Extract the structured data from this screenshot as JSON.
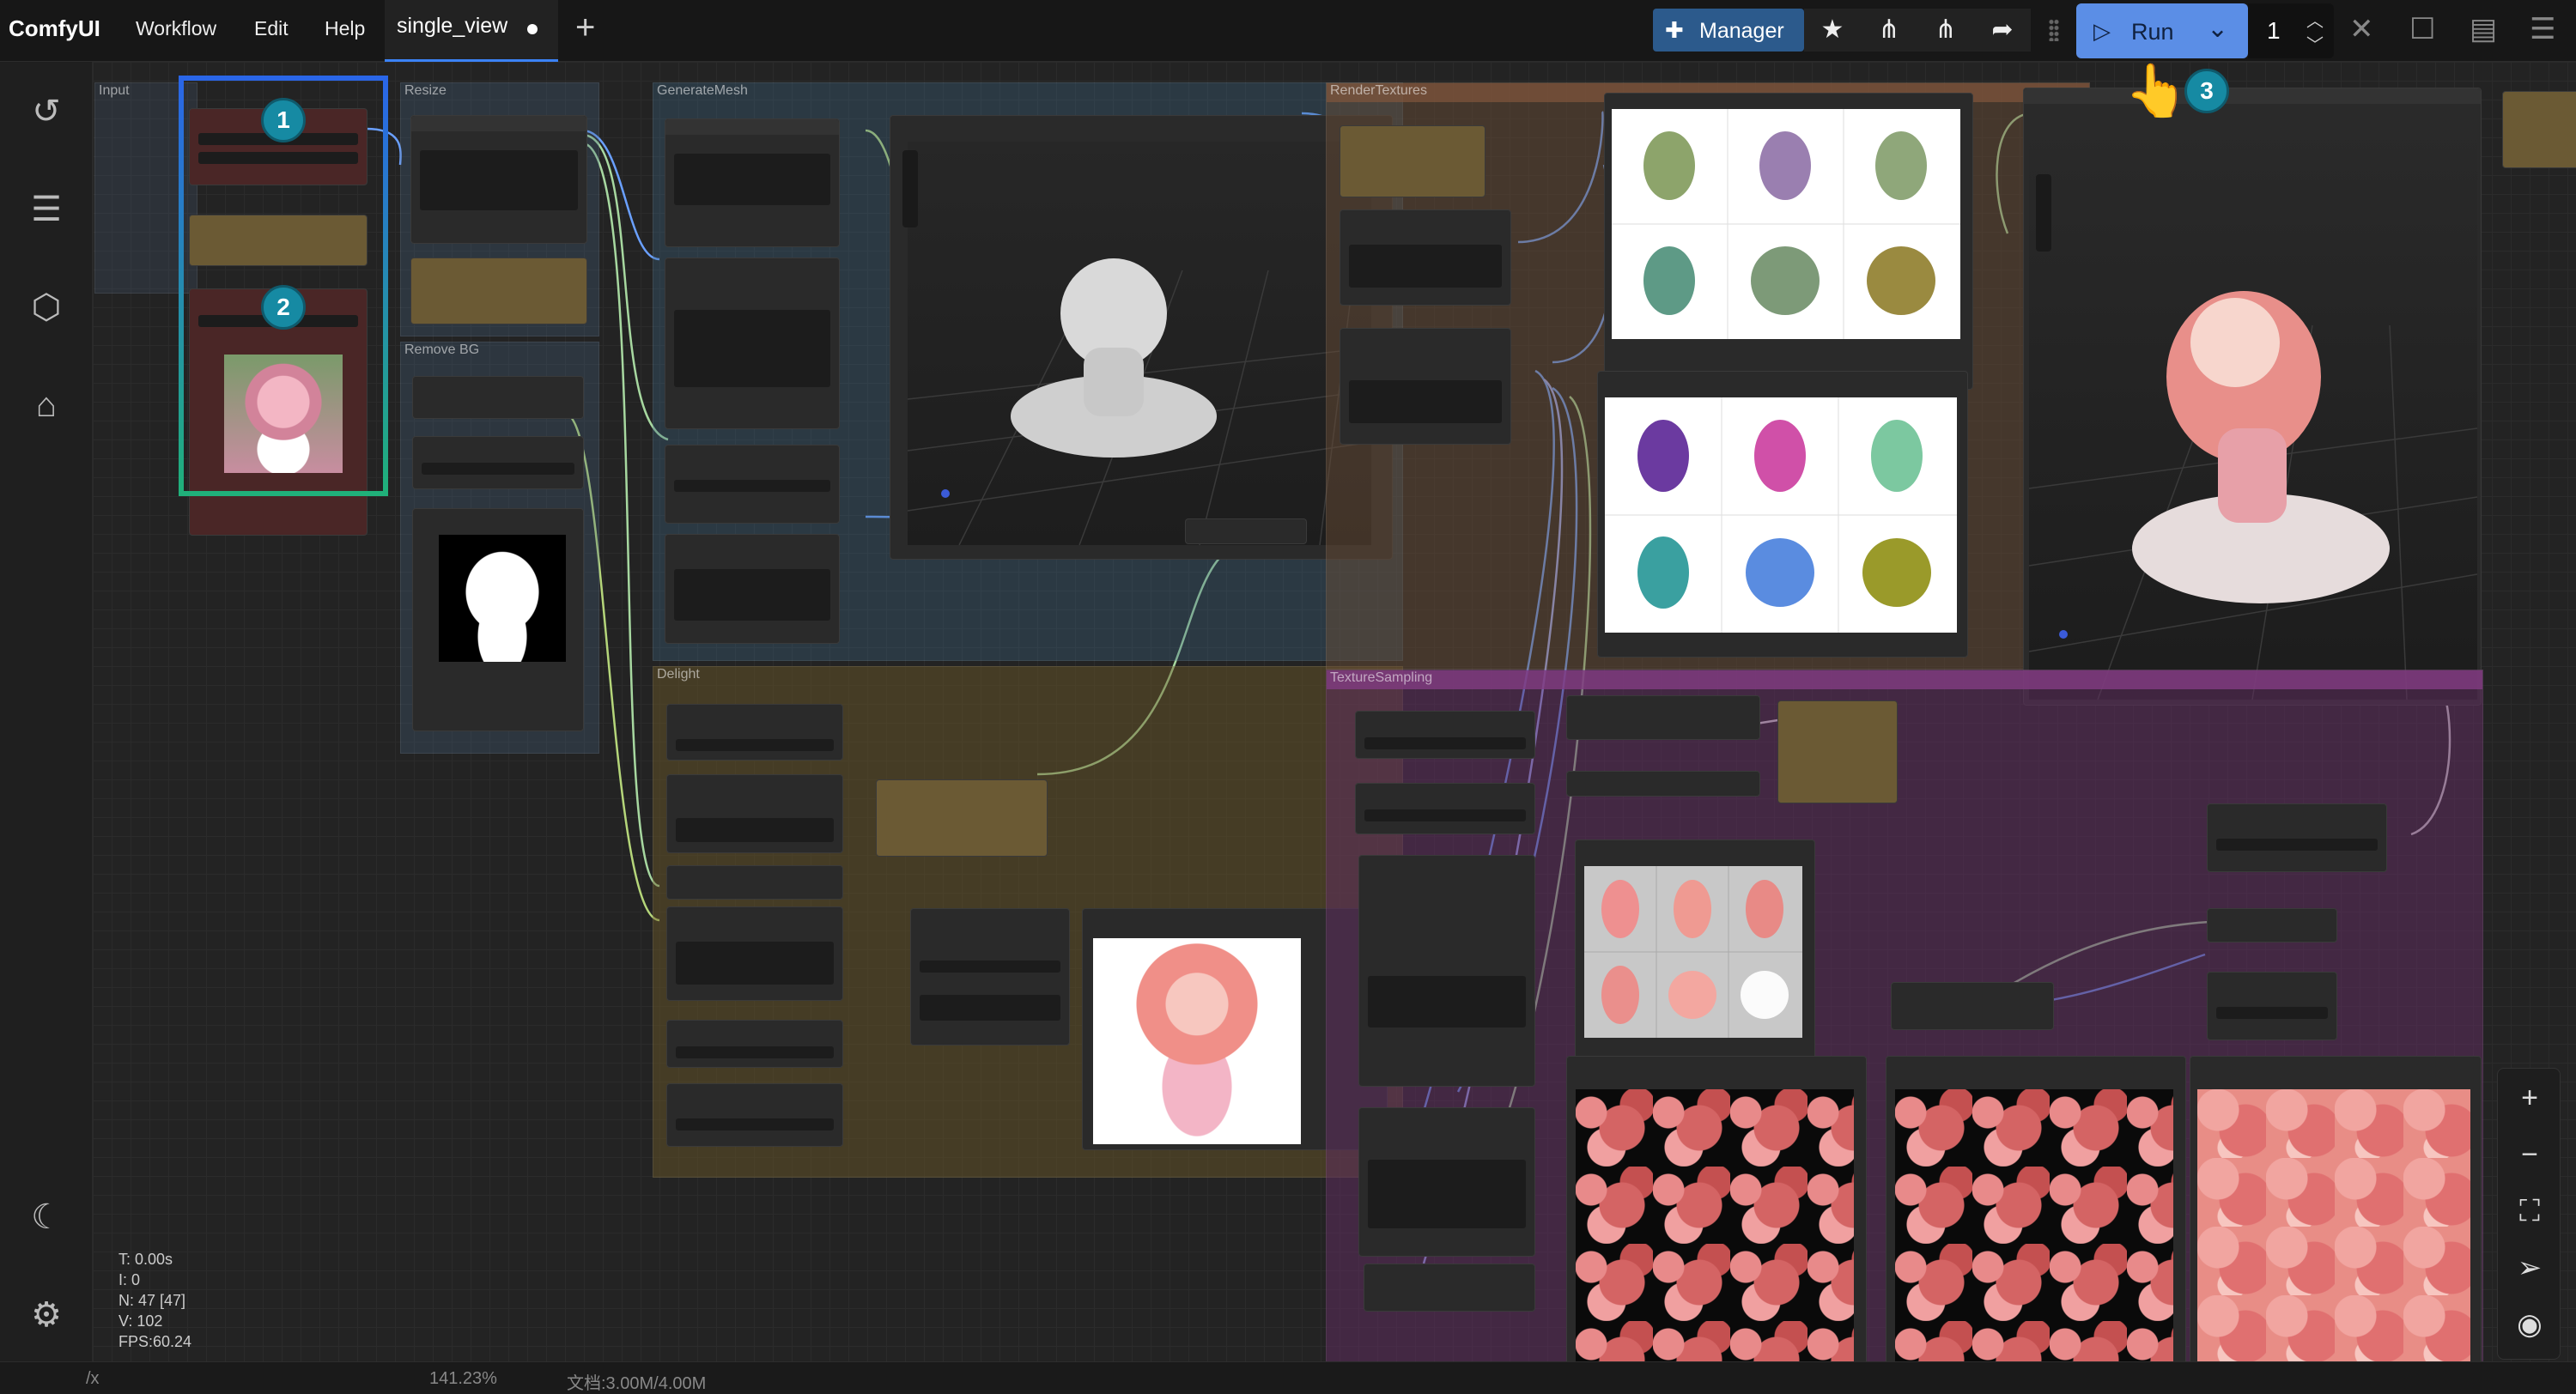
{
  "app": {
    "name": "ComfyUI"
  },
  "menu": [
    "Workflow",
    "Edit",
    "Help"
  ],
  "tab": {
    "label": "single_view"
  },
  "toolbar": {
    "manager_label": "Manager",
    "run_label": "Run",
    "batch_count": "1"
  },
  "annotations": {
    "badge1": "1",
    "badge2": "2",
    "badge3": "3"
  },
  "groups": {
    "input": "Input",
    "resize": "Resize",
    "remove_bg": "Remove BG",
    "generate_mesh": "GenerateMesh",
    "delight": "Delight",
    "render_textures": "RenderTextures",
    "texture_sampling": "TextureSampling"
  },
  "stats": {
    "t": "T: 0.00s",
    "i": "I: 0",
    "n": "N: 47 [47]",
    "v": "V: 102",
    "fps": "FPS:60.24"
  },
  "status": {
    "zoom": "141.23%",
    "doc": "文档:3.00M/4.00M",
    "fx": "/x"
  },
  "colors": {
    "accent": "#5b8ee6",
    "manager": "#2c5a8c",
    "badge": "#168aa3",
    "input_frame_top": "#2a66e8",
    "input_frame_bottom": "#20b07a"
  }
}
